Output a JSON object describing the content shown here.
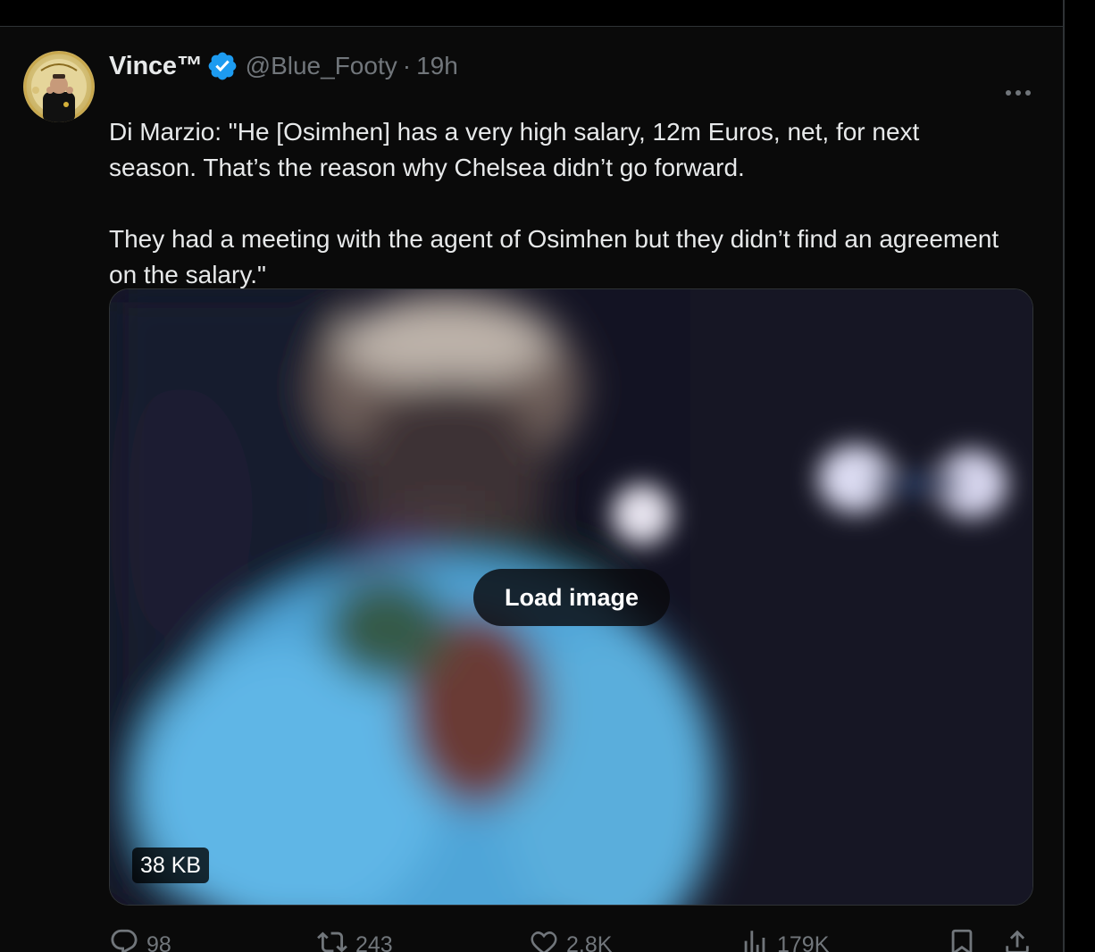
{
  "tweet": {
    "author": {
      "name": "Vince™",
      "handle": "@Blue_Footy",
      "verified": true
    },
    "separator": "·",
    "time": "19h",
    "text": [
      "Di Marzio: \"He [Osimhen] has a very high salary, 12m Euros, net, for next season. That’s the reason why Chelsea didn’t go forward.",
      "They had a meeting with the agent of Osimhen but they didn’t find an agreement on the salary.\""
    ],
    "media": {
      "load_label": "Load image",
      "size": "38 KB"
    },
    "actions": {
      "replies": "98",
      "reposts": "243",
      "likes": "2.8K",
      "views": "179K"
    }
  },
  "icons": {
    "more": "more-horizontal-icon",
    "verified": "verified-badge-icon",
    "reply": "reply-icon",
    "repost": "repost-icon",
    "like": "heart-icon",
    "views": "bar-chart-icon",
    "bookmark": "bookmark-icon",
    "share": "share-icon"
  },
  "colors": {
    "background": "#0a0a0a",
    "text": "#e7e9ea",
    "muted": "#71767b",
    "verified": "#1d9bf0",
    "border": "#2f3336"
  }
}
